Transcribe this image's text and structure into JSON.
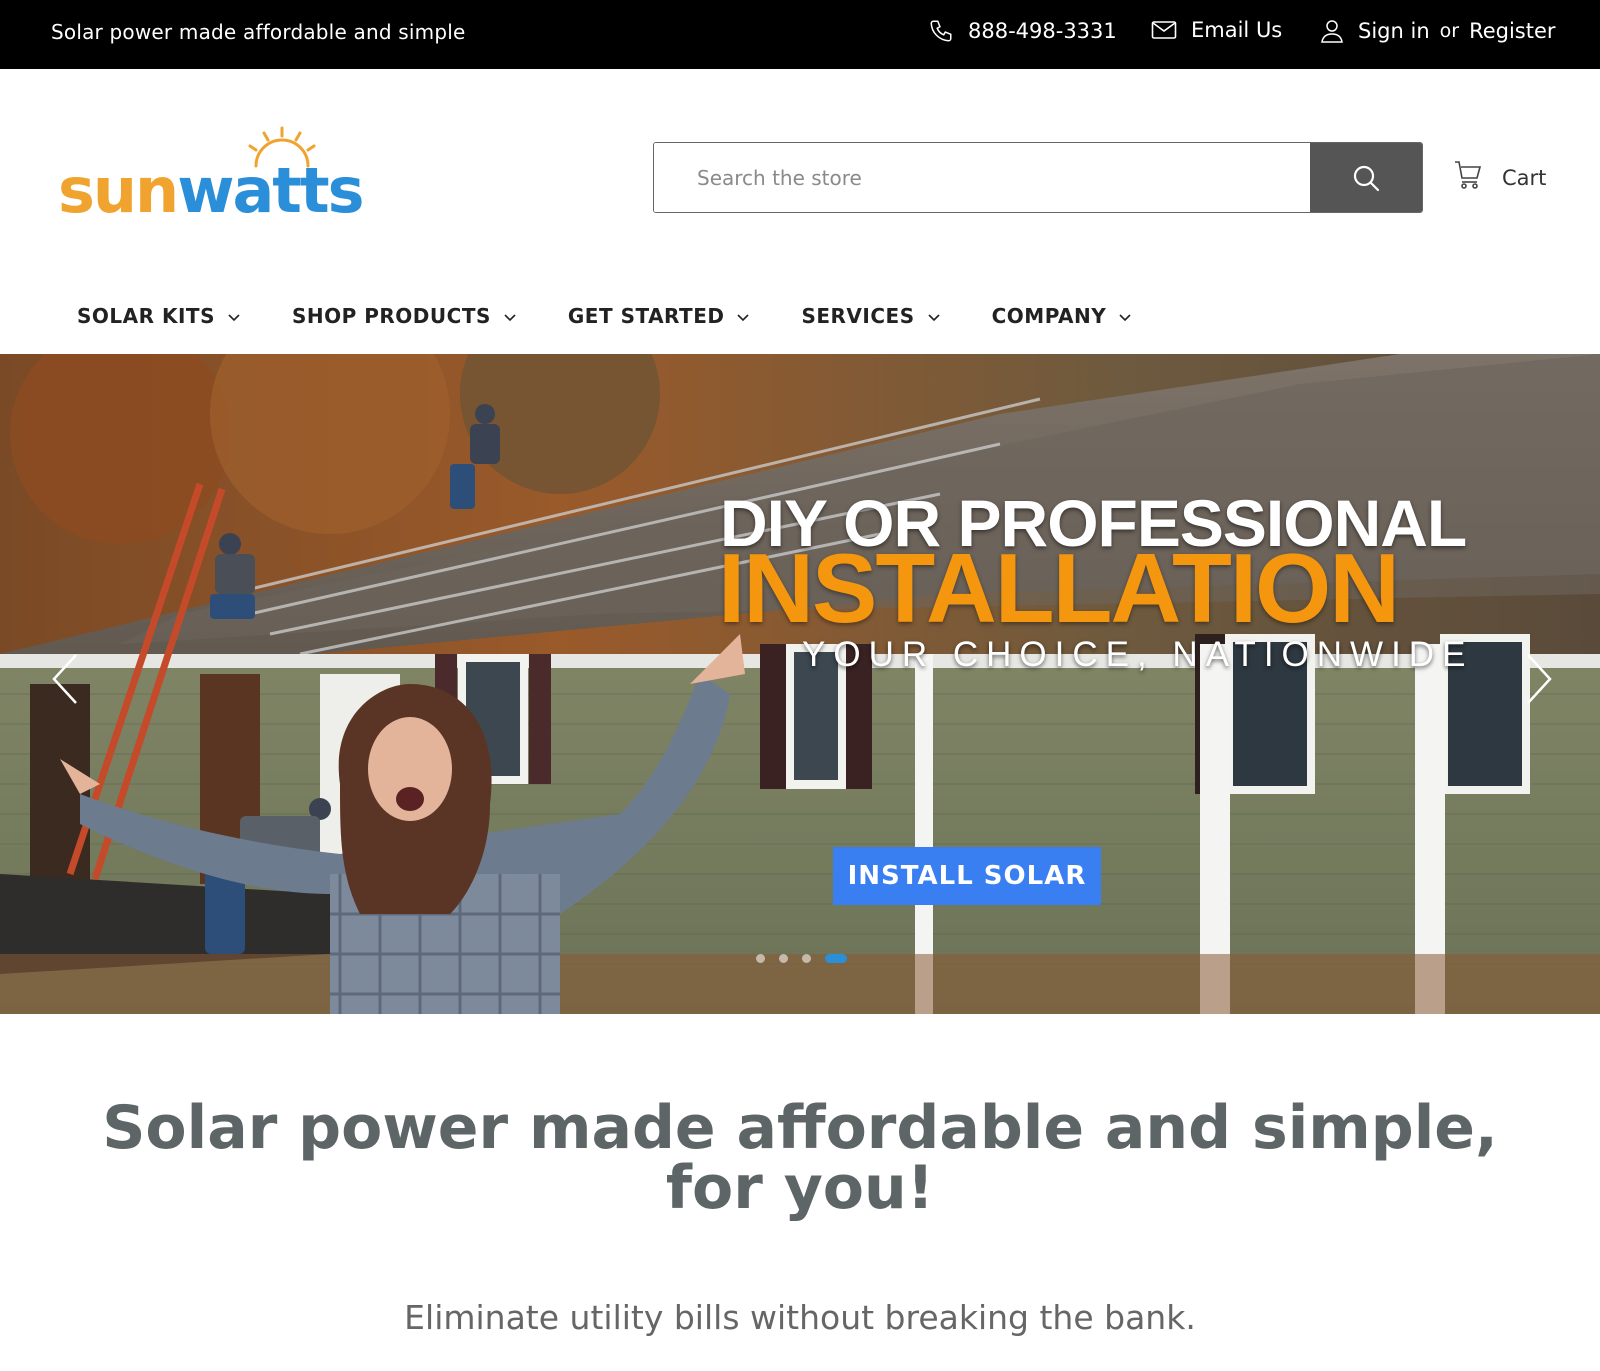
{
  "topbar": {
    "tagline": "Solar power made affordable and simple",
    "phone": "888-498-3331",
    "email_label": "Email Us",
    "signin_label": "Sign in",
    "or_label": "or",
    "register_label": "Register"
  },
  "logo": {
    "part1": "sun",
    "part2": "watts",
    "colors": {
      "sun": "#f0a32e",
      "watts": "#2a8ed8"
    }
  },
  "search": {
    "placeholder": "Search the store",
    "button_icon": "search-icon"
  },
  "cart": {
    "label": "Cart",
    "icon": "cart-icon"
  },
  "nav": {
    "items": [
      {
        "label": "SOLAR KITS"
      },
      {
        "label": "SHOP PRODUCTS"
      },
      {
        "label": "GET STARTED"
      },
      {
        "label": "SERVICES"
      },
      {
        "label": "COMPANY"
      }
    ]
  },
  "hero": {
    "line1": "DIY OR PROFESSIONAL",
    "line2": "INSTALLATION",
    "line3": "YOUR CHOICE, NATIONWIDE",
    "cta": "INSTALL SOLAR",
    "slide_count": 4,
    "active_slide": 4,
    "colors": {
      "accent": "#f5960f",
      "cta": "#3a7ff2"
    }
  },
  "content": {
    "headline": "Solar power made affordable and simple, for you!",
    "subline": "Eliminate utility bills without breaking the bank."
  }
}
